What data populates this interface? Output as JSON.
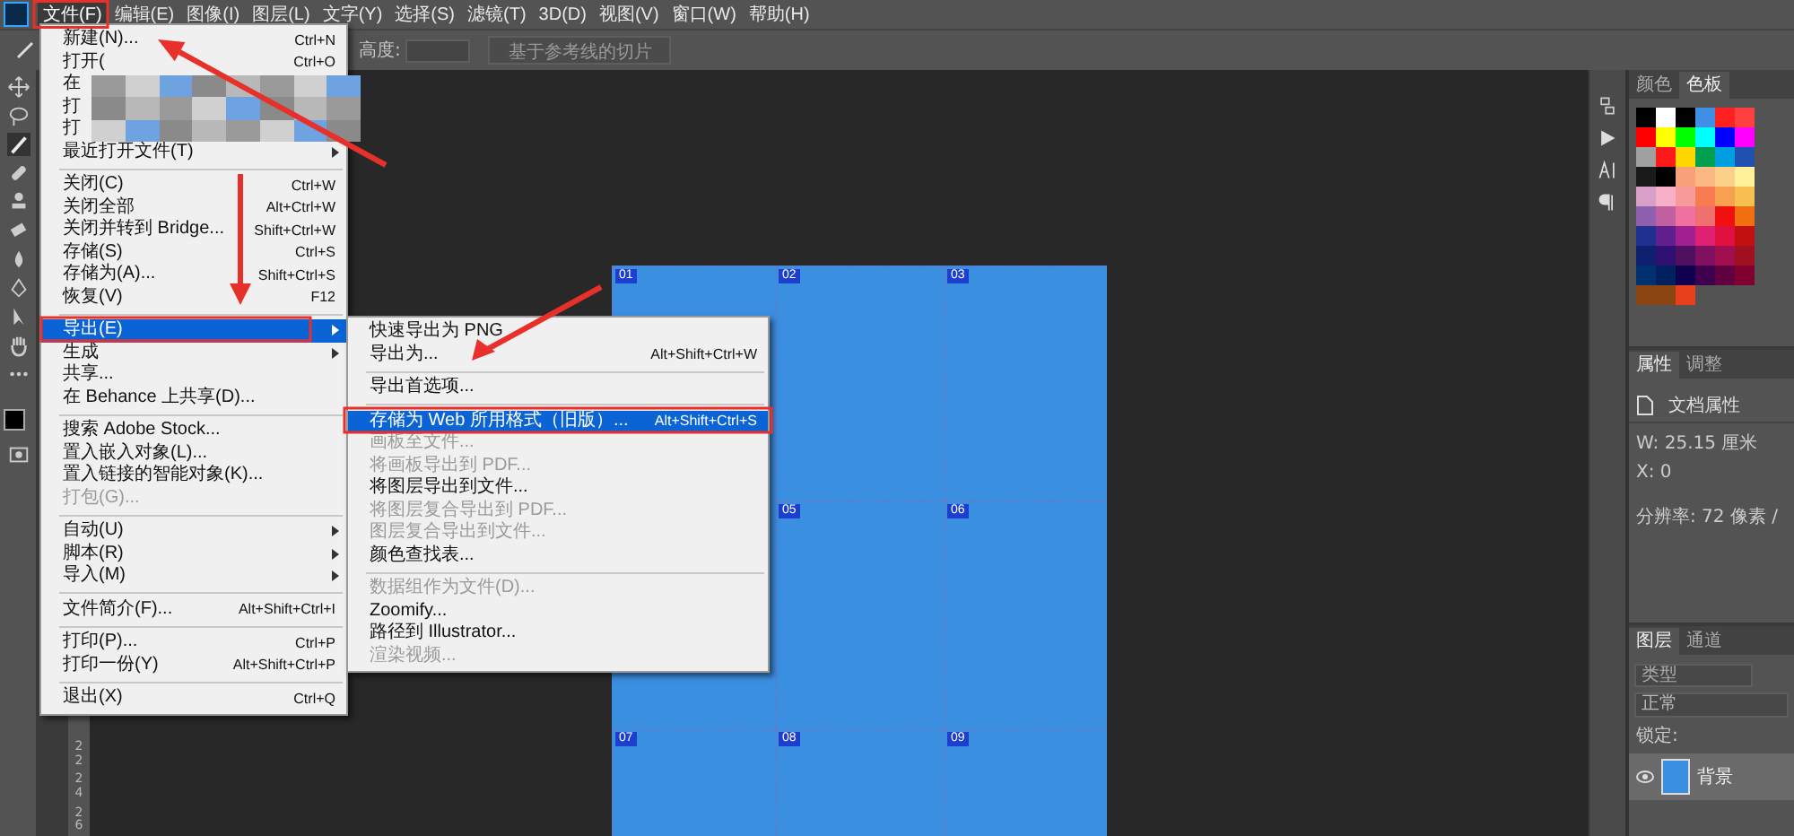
{
  "menubar": {
    "items": [
      {
        "label": "文件(F)",
        "selected": true
      },
      {
        "label": "编辑(E)",
        "selected": false
      },
      {
        "label": "图像(I)",
        "selected": false
      },
      {
        "label": "图层(L)",
        "selected": false
      },
      {
        "label": "文字(Y)",
        "selected": false
      },
      {
        "label": "选择(S)",
        "selected": false
      },
      {
        "label": "滤镜(T)",
        "selected": false
      },
      {
        "label": "3D(D)",
        "selected": false
      },
      {
        "label": "视图(V)",
        "selected": false
      },
      {
        "label": "窗口(W)",
        "selected": false
      },
      {
        "label": "帮助(H)",
        "selected": false
      }
    ]
  },
  "options_bar": {
    "field_label": "高度:",
    "slice_button": "基于参考线的切片"
  },
  "file_menu": {
    "items": [
      {
        "kind": "item",
        "label": "新建(N)...",
        "shortcut": "Ctrl+N",
        "submenu": false,
        "disabled": false,
        "selected": false
      },
      {
        "kind": "item",
        "label": "打开(",
        "shortcut": "Ctrl+O",
        "submenu": false,
        "disabled": false,
        "selected": false
      },
      {
        "kind": "item",
        "label": "在",
        "submenu": false,
        "disabled": false,
        "selected": false
      },
      {
        "kind": "item",
        "label": "打",
        "submenu": false,
        "disabled": false,
        "selected": false
      },
      {
        "kind": "item",
        "label": "打",
        "submenu": false,
        "disabled": false,
        "selected": false
      },
      {
        "kind": "item",
        "label": "最近打开文件(T)",
        "submenu": true,
        "disabled": false,
        "selected": false
      },
      {
        "kind": "separator"
      },
      {
        "kind": "item",
        "label": "关闭(C)",
        "shortcut": "Ctrl+W",
        "submenu": false,
        "disabled": false,
        "selected": false
      },
      {
        "kind": "item",
        "label": "关闭全部",
        "shortcut": "Alt+Ctrl+W",
        "submenu": false,
        "disabled": false,
        "selected": false
      },
      {
        "kind": "item",
        "label": "关闭并转到 Bridge...",
        "shortcut": "Shift+Ctrl+W",
        "submenu": false,
        "disabled": false,
        "selected": false
      },
      {
        "kind": "item",
        "label": "存储(S)",
        "shortcut": "Ctrl+S",
        "submenu": false,
        "disabled": false,
        "selected": false
      },
      {
        "kind": "item",
        "label": "存储为(A)...",
        "shortcut": "Shift+Ctrl+S",
        "submenu": false,
        "disabled": false,
        "selected": false
      },
      {
        "kind": "item",
        "label": "恢复(V)",
        "shortcut": "F12",
        "submenu": false,
        "disabled": false,
        "selected": false
      },
      {
        "kind": "separator"
      },
      {
        "kind": "item",
        "label": "导出(E)",
        "submenu": true,
        "disabled": false,
        "selected": true
      },
      {
        "kind": "item",
        "label": "生成",
        "submenu": true,
        "disabled": false,
        "selected": false
      },
      {
        "kind": "item",
        "label": "共享...",
        "submenu": false,
        "disabled": false,
        "selected": false
      },
      {
        "kind": "item",
        "label": "在 Behance 上共享(D)...",
        "submenu": false,
        "disabled": false,
        "selected": false
      },
      {
        "kind": "separator"
      },
      {
        "kind": "item",
        "label": "搜索 Adobe Stock...",
        "submenu": false,
        "disabled": false,
        "selected": false
      },
      {
        "kind": "item",
        "label": "置入嵌入对象(L)...",
        "submenu": false,
        "disabled": false,
        "selected": false
      },
      {
        "kind": "item",
        "label": "置入链接的智能对象(K)...",
        "submenu": false,
        "disabled": false,
        "selected": false
      },
      {
        "kind": "item",
        "label": "打包(G)...",
        "submenu": false,
        "disabled": true,
        "selected": false
      },
      {
        "kind": "separator"
      },
      {
        "kind": "item",
        "label": "自动(U)",
        "submenu": true,
        "disabled": false,
        "selected": false
      },
      {
        "kind": "item",
        "label": "脚本(R)",
        "submenu": true,
        "disabled": false,
        "selected": false
      },
      {
        "kind": "item",
        "label": "导入(M)",
        "submenu": true,
        "disabled": false,
        "selected": false
      },
      {
        "kind": "separator"
      },
      {
        "kind": "item",
        "label": "文件简介(F)...",
        "shortcut": "Alt+Shift+Ctrl+I",
        "submenu": false,
        "disabled": false,
        "selected": false
      },
      {
        "kind": "separator"
      },
      {
        "kind": "item",
        "label": "打印(P)...",
        "shortcut": "Ctrl+P",
        "submenu": false,
        "disabled": false,
        "selected": false
      },
      {
        "kind": "item",
        "label": "打印一份(Y)",
        "shortcut": "Alt+Shift+Ctrl+P",
        "submenu": false,
        "disabled": false,
        "selected": false
      },
      {
        "kind": "separator"
      },
      {
        "kind": "item",
        "label": "退出(X)",
        "shortcut": "Ctrl+Q",
        "submenu": false,
        "disabled": false,
        "selected": false
      }
    ]
  },
  "export_submenu": {
    "items": [
      {
        "kind": "item",
        "label": "快速导出为 PNG",
        "disabled": false,
        "selected": false
      },
      {
        "kind": "item",
        "label": "导出为...",
        "shortcut": "Alt+Shift+Ctrl+W",
        "disabled": false,
        "selected": false
      },
      {
        "kind": "separator"
      },
      {
        "kind": "item",
        "label": "导出首选项...",
        "disabled": false,
        "selected": false
      },
      {
        "kind": "separator"
      },
      {
        "kind": "item",
        "label": "存储为 Web 所用格式（旧版）...",
        "shortcut": "Alt+Shift+Ctrl+S",
        "disabled": false,
        "selected": true
      },
      {
        "kind": "item",
        "label": "画板至文件...",
        "disabled": true,
        "selected": false
      },
      {
        "kind": "item",
        "label": "将画板导出到 PDF...",
        "disabled": true,
        "selected": false
      },
      {
        "kind": "item",
        "label": "将图层导出到文件...",
        "disabled": false,
        "selected": false
      },
      {
        "kind": "item",
        "label": "将图层复合导出到 PDF...",
        "disabled": true,
        "selected": false
      },
      {
        "kind": "item",
        "label": "图层复合导出到文件...",
        "disabled": true,
        "selected": false
      },
      {
        "kind": "item",
        "label": "颜色查找表...",
        "disabled": false,
        "selected": false
      },
      {
        "kind": "separator"
      },
      {
        "kind": "item",
        "label": "数据组作为文件(D)...",
        "disabled": true,
        "selected": false
      },
      {
        "kind": "item",
        "label": "Zoomify...",
        "disabled": false,
        "selected": false
      },
      {
        "kind": "item",
        "label": "路径到 Illustrator...",
        "disabled": false,
        "selected": false
      },
      {
        "kind": "item",
        "label": "渲染视频...",
        "disabled": true,
        "selected": false
      }
    ]
  },
  "document": {
    "slices": [
      {
        "label": "01"
      },
      {
        "label": "02"
      },
      {
        "label": "03"
      },
      {
        "label": "05"
      },
      {
        "label": "06"
      },
      {
        "label": "07"
      },
      {
        "label": "08"
      },
      {
        "label": "09"
      }
    ]
  },
  "ruler": {
    "labels": [
      "22",
      "24",
      "26"
    ]
  },
  "swatches_panel": {
    "tabs": [
      {
        "label": "颜色",
        "selected": false
      },
      {
        "label": "色板",
        "selected": true
      }
    ],
    "swatches": [
      {
        "color": "#000000"
      },
      {
        "color": "#ffffff"
      },
      {
        "color": "#000000"
      },
      {
        "color": "#3f8fe4"
      },
      {
        "color": "#ff2020"
      },
      {
        "color": "#ff4040"
      },
      {
        "color": "#ff0000"
      },
      {
        "color": "#ffff00"
      },
      {
        "color": "#00ff00"
      },
      {
        "color": "#00ffff"
      },
      {
        "color": "#0000ff"
      },
      {
        "color": "#ff00ff"
      },
      {
        "color": "#a0a0a0"
      },
      {
        "color": "#ff1a1a"
      },
      {
        "color": "#ffd700"
      },
      {
        "color": "#00a050"
      },
      {
        "color": "#00a0e0"
      },
      {
        "color": "#2050b0"
      },
      {
        "color": "#1a1a1a"
      },
      {
        "color": "#000000"
      },
      {
        "color": "#f7a07a"
      },
      {
        "color": "#fbb882"
      },
      {
        "color": "#fdd08a"
      },
      {
        "color": "#fff09a"
      },
      {
        "color": "#d8a0c8"
      },
      {
        "color": "#f7b0c8"
      },
      {
        "color": "#f79a9a"
      },
      {
        "color": "#f77a50"
      },
      {
        "color": "#f7a050"
      },
      {
        "color": "#f7c050"
      },
      {
        "color": "#9060b0"
      },
      {
        "color": "#c060a0"
      },
      {
        "color": "#f070a0"
      },
      {
        "color": "#f07070"
      },
      {
        "color": "#f01010"
      },
      {
        "color": "#f07010"
      },
      {
        "color": "#203090"
      },
      {
        "color": "#602090"
      },
      {
        "color": "#a02090"
      },
      {
        "color": "#e02070"
      },
      {
        "color": "#e01040"
      },
      {
        "color": "#c01010"
      },
      {
        "color": "#102070"
      },
      {
        "color": "#301070"
      },
      {
        "color": "#501060"
      },
      {
        "color": "#801060"
      },
      {
        "color": "#a01050"
      },
      {
        "color": "#a01020"
      },
      {
        "color": "#003070"
      },
      {
        "color": "#002060"
      },
      {
        "color": "#100050"
      },
      {
        "color": "#400050"
      },
      {
        "color": "#600040"
      },
      {
        "color": "#800030"
      },
      {
        "color": "#8b4513"
      },
      {
        "color": "#8b4513"
      },
      {
        "color": "#e8401a"
      }
    ]
  },
  "properties_panel": {
    "tabs": [
      {
        "label": "属性",
        "selected": true
      },
      {
        "label": "调整",
        "selected": false
      }
    ],
    "heading": "文档属性",
    "width": "W: 25.15 厘米",
    "x": "X: 0",
    "resolution": "分辨率: 72 像素 /"
  },
  "layers_panel": {
    "tabs": [
      {
        "label": "图层",
        "selected": true
      },
      {
        "label": "通道",
        "selected": false
      }
    ],
    "filter_placeholder": "类型",
    "blend_mode": "正常",
    "lock_label": "锁定:",
    "layers": [
      {
        "name": "背景",
        "visible": true,
        "selected": true
      }
    ]
  }
}
